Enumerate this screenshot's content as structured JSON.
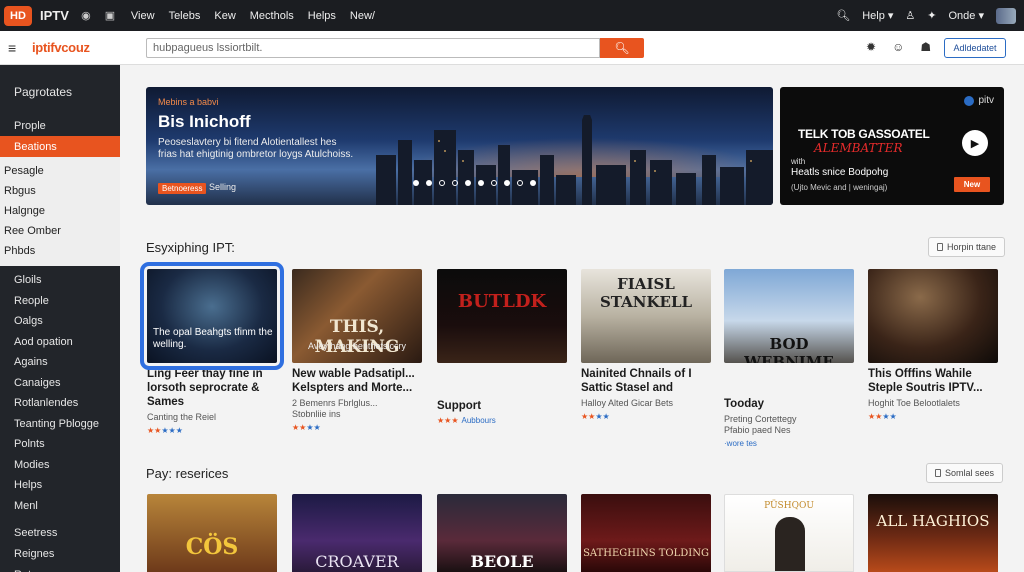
{
  "topbar": {
    "logo": "HD",
    "app_name": "IPTV",
    "menu": [
      "View",
      "Telebs",
      "Kew",
      "Mecthols",
      "Helps",
      "New/"
    ],
    "help": "Help",
    "user": "Onde"
  },
  "header": {
    "brand": "iptifvcouz",
    "search_placeholder": "hubpagueus lssiortbilt.",
    "account_button": "Adldedatet"
  },
  "sidebar": {
    "title": "Pagrotates",
    "items_top": [
      "Prople",
      "Beations"
    ],
    "group1": [
      "Pesagle",
      "Rbgus",
      "Halgnge",
      "Ree Omber",
      "Phbds"
    ],
    "group2": [
      "Gloils",
      "Reople",
      "Oalgs",
      "Aod opation",
      "Agains",
      "Canaiges",
      "Rotlanlendes",
      "Teanting Pblogge",
      "Polnts",
      "Modies",
      "Helps",
      "Menl"
    ],
    "group3": [
      "Seetress",
      "Reignes",
      "Rotuses"
    ]
  },
  "hero": {
    "tag": "Mebins a babvi",
    "title": "Bis Inichoff",
    "description": "Peoseslavtery bi fitend Alotientallest hes frias hat ehigtinig ombretor loygs Atulchoiss.",
    "pill": "Betnoeress",
    "pill_label": "Selling"
  },
  "promo": {
    "brand": "pitv",
    "title": "TELK TOB GASSOATEL",
    "script": "ALEMBATTER",
    "with": "with",
    "subtitle": "Heatls snice Bodpohg",
    "subtitle2": "(Ujto Mevic and | weningaj)",
    "button": "New"
  },
  "section1": {
    "title": "Esyxiphing IPT:",
    "button": "Horpin ttane",
    "cards": [
      {
        "overlay": "The opal Beahgts tfinm the welling.",
        "title": "Ling Feer thay fine in lorsoth seprocrate & Sames",
        "meta": [
          "Canting the Reiel"
        ],
        "rating_on": 2,
        "rating_label": ""
      },
      {
        "overlay": "THIS, MAKING",
        "overlay2": "Avey hang benthetsiccry",
        "title": "New wable Padsatipl... Kelspters and Morte...",
        "meta": [
          "2 Bemenrs Fbrlglus...",
          "Stobnliie ins"
        ],
        "rating_on": 2,
        "rating_label": ""
      },
      {
        "overlay": "BUTLDK",
        "title": "Support",
        "meta": [],
        "rating_on": 3,
        "rating_label": "Aubbours"
      },
      {
        "overlay": "FIAISL STANKELL",
        "title": "Nainited Chnails of I Sattic Stasel and",
        "meta": [
          "Halloy Alted Gicar Bets"
        ],
        "rating_on": 2,
        "rating_label": ""
      },
      {
        "overlay": "BOD WEBNIME",
        "title": "Tooday",
        "meta": [
          "Preting Cortettegy",
          "Pfabio paed Nes"
        ],
        "rating_on": 0,
        "rating_label": "",
        "extra": "·wore tes"
      },
      {
        "overlay": "",
        "title": "This Offfins Wahile Steple Soutris IPTV...",
        "meta": [
          "Hoghit Toe Belootlalets"
        ],
        "rating_on": 2,
        "rating_label": ""
      }
    ]
  },
  "section2": {
    "title": "Pay: reserices",
    "button": "Somlal sees",
    "cards": [
      {
        "overlay": "CÖS"
      },
      {
        "overlay": "CROAVER"
      },
      {
        "overlay": "BEOLE"
      },
      {
        "overlay": "SATHEGHINS TOLDING"
      },
      {
        "overlay": "PÜSHQOU"
      },
      {
        "overlay": "ALL HAGHIOS"
      }
    ]
  },
  "colors": {
    "accent": "#e8541f",
    "sidebar_bg": "#22252a",
    "link": "#2b6cc4"
  }
}
